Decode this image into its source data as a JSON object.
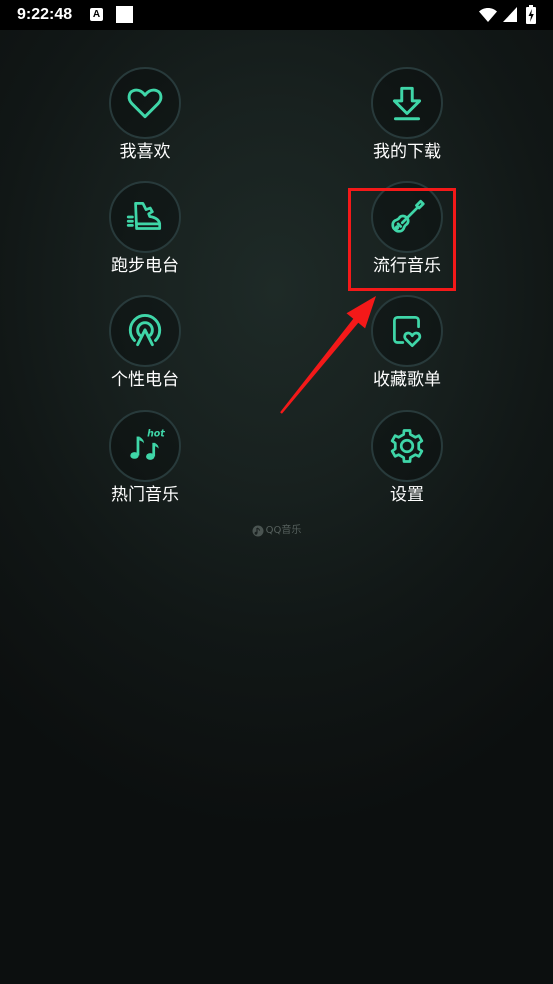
{
  "status_bar": {
    "time": "9:22:48",
    "notification_badge_letter": "A",
    "icons": [
      "a-badge-icon",
      "notification-square-icon",
      "wifi-icon",
      "signal-icon",
      "battery-charging-icon"
    ]
  },
  "colors": {
    "accent": "#3fd6a8",
    "annotation": "#f41919",
    "label": "#ffffff"
  },
  "menu": {
    "items": [
      {
        "label": "我喜欢",
        "icon": "heart-icon"
      },
      {
        "label": "我的下载",
        "icon": "download-icon"
      },
      {
        "label": "跑步电台",
        "icon": "running-shoe-icon"
      },
      {
        "label": "流行音乐",
        "icon": "guitar-icon",
        "highlighted": true
      },
      {
        "label": "个性电台",
        "icon": "radio-broadcast-icon"
      },
      {
        "label": "收藏歌单",
        "icon": "playlist-heart-icon"
      },
      {
        "label": "热门音乐",
        "icon": "hot-music-icon",
        "icon_text": "hot"
      },
      {
        "label": "设置",
        "icon": "gear-icon"
      }
    ]
  },
  "footer": {
    "logo_text": "QQ音乐",
    "logo_icon": "qq-music-logo-icon"
  }
}
